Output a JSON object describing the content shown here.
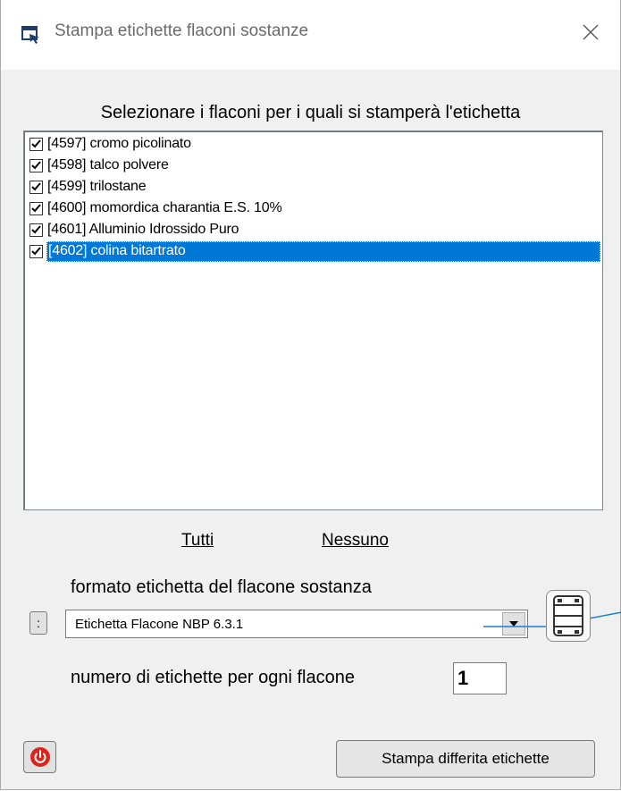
{
  "window": {
    "title": "Stampa etichette flaconi sostanze",
    "title_icon": "window-app-icon",
    "close_icon": "close-icon"
  },
  "heading": "Selezionare  i flaconi per i quali si stamperà l'etichetta",
  "list": {
    "items": [
      {
        "label": "[4597] cromo picolinato",
        "checked": true,
        "selected": false
      },
      {
        "label": "[4598] talco polvere",
        "checked": true,
        "selected": false
      },
      {
        "label": "[4599] trilostane",
        "checked": true,
        "selected": false
      },
      {
        "label": "[4600] momordica charantia E.S. 10%",
        "checked": true,
        "selected": false
      },
      {
        "label": "[4601] Alluminio Idrossido Puro",
        "checked": true,
        "selected": false
      },
      {
        "label": "[4602] colina bitartrato",
        "checked": true,
        "selected": true
      }
    ]
  },
  "links": {
    "all": "Tutti",
    "none": "Nessuno"
  },
  "format": {
    "label": "formato etichetta del flacone sostanza",
    "small_button": ":",
    "value": "Etichetta Flacone NBP 6.3.1",
    "dropdown_icon": "dropdown-arrow-icon",
    "film_icon": "film-strip-icon"
  },
  "count": {
    "label": "numero di etichette per ogni flacone",
    "value": "1"
  },
  "buttons": {
    "power_icon": "power-icon",
    "print_label": "Stampa differita etichette"
  },
  "colors": {
    "selection": "#0078d7",
    "accent_line": "#1a7fd4",
    "power": "#d9261c"
  }
}
